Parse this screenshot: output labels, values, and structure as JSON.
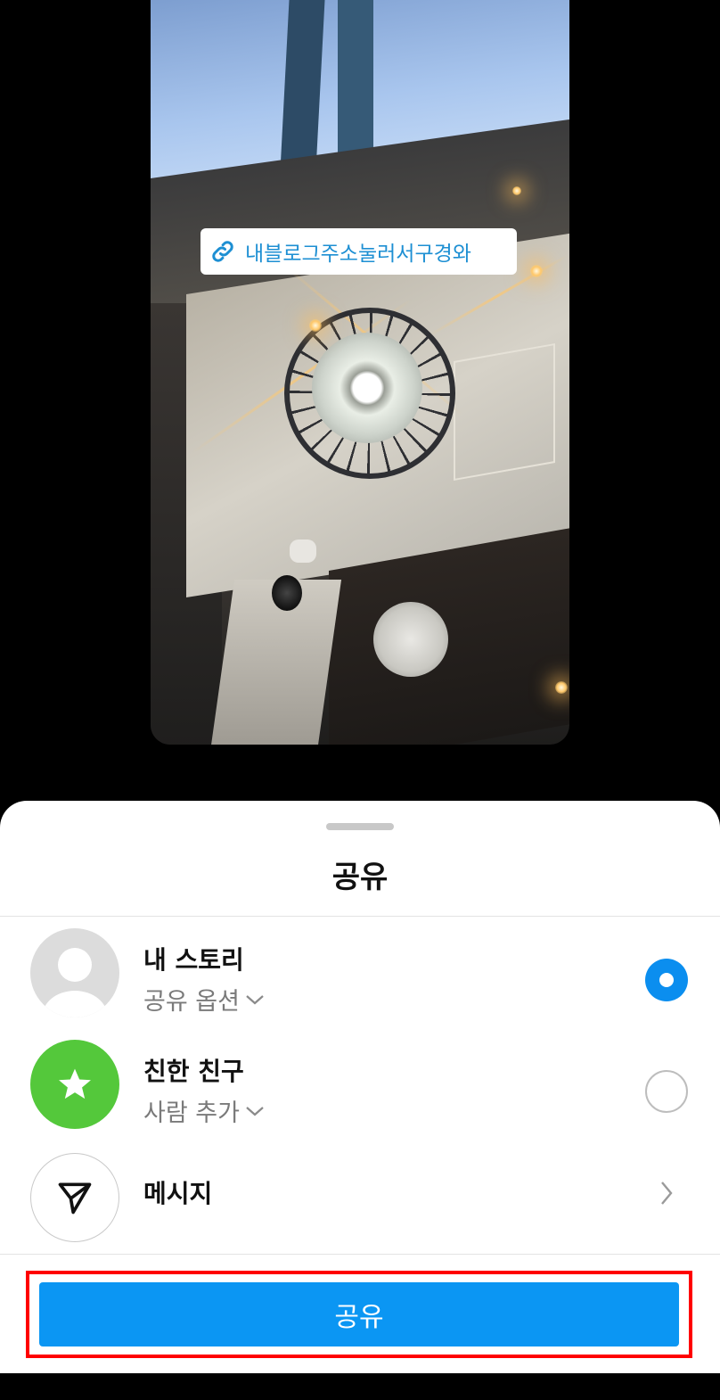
{
  "story": {
    "link_sticker": {
      "icon": "link-icon",
      "text": "내블로그주소눌러서구경와",
      "color": "#1d8fd3"
    }
  },
  "sheet": {
    "title": "공유",
    "options": [
      {
        "title": "내 스토리",
        "subtitle": "공유 옵션",
        "selected": true,
        "icon": "profile-icon"
      },
      {
        "title": "친한 친구",
        "subtitle": "사람 추가",
        "selected": false,
        "icon": "star-icon"
      },
      {
        "title": "메시지",
        "icon": "paper-plane-icon"
      }
    ],
    "share_button_label": "공유",
    "accent_color": "#0b96f3",
    "annotation_color": "#ff0000"
  }
}
